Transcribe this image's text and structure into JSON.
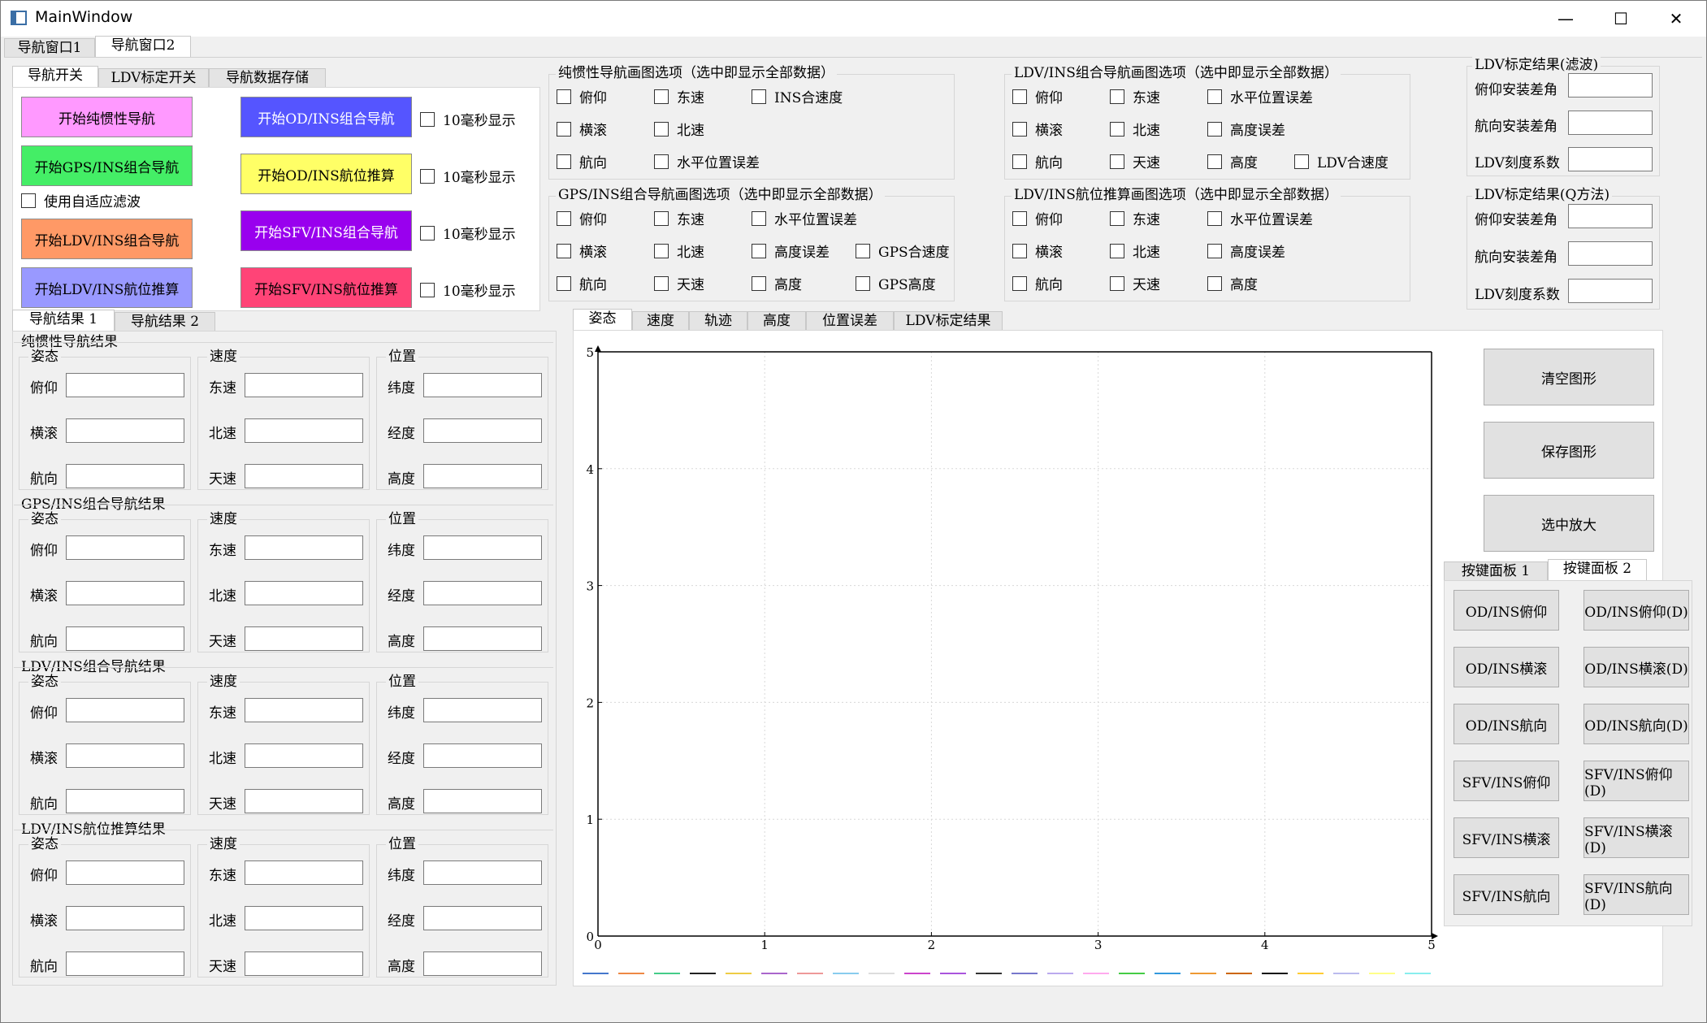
{
  "window": {
    "title": "MainWindow",
    "icons": {
      "minimize": "minimize-icon",
      "maximize": "maximize-icon",
      "close": "close-icon"
    }
  },
  "main_tabs": [
    {
      "label": "导航窗口1"
    },
    {
      "label": "导航窗口2"
    }
  ],
  "switch_tabs": [
    {
      "label": "导航开关"
    },
    {
      "label": "LDV标定开关"
    },
    {
      "label": "导航数据存储"
    }
  ],
  "nav_buttons": {
    "pure_ins": "开始纯惯性导航",
    "gps_ins": "开始GPS/INS组合导航",
    "ldv_ins": "开始LDV/INS组合导航",
    "ldv_dr": "开始LDV/INS航位推算",
    "od_ins": "开始OD/INS组合导航",
    "od_dr": "开始OD/INS航位推算",
    "sfv_ins": "开始SFV/INS组合导航",
    "sfv_dr": "开始SFV/INS航位推算"
  },
  "adaptive_filter": "使用自适应滤波",
  "ms10": "10毫秒显示",
  "plot_groups": [
    {
      "title": "纯惯性导航画图选项（选中即显示全部数据）",
      "items": [
        "俯仰",
        "东速",
        "INS合速度",
        "横滚",
        "北速",
        "航向",
        "水平位置误差"
      ]
    },
    {
      "title": "LDV/INS组合导航画图选项（选中即显示全部数据）",
      "items": [
        "俯仰",
        "东速",
        "水平位置误差",
        "横滚",
        "北速",
        "高度误差",
        "航向",
        "天速",
        "高度",
        "LDV合速度"
      ]
    },
    {
      "title": "GPS/INS组合导航画图选项（选中即显示全部数据）",
      "items": [
        "俯仰",
        "东速",
        "水平位置误差",
        "横滚",
        "北速",
        "高度误差",
        "GPS合速度",
        "航向",
        "天速",
        "高度",
        "GPS高度"
      ]
    },
    {
      "title": "LDV/INS航位推算画图选项（选中即显示全部数据）",
      "items": [
        "俯仰",
        "东速",
        "水平位置误差",
        "横滚",
        "北速",
        "高度误差",
        "航向",
        "天速",
        "高度"
      ]
    }
  ],
  "ldv_calib": [
    {
      "title": "LDV标定结果(滤波)",
      "rows": [
        "俯仰安装差角",
        "航向安装差角",
        "LDV刻度系数"
      ]
    },
    {
      "title": "LDV标定结果(Q方法)",
      "rows": [
        "俯仰安装差角",
        "航向安装差角",
        "LDV刻度系数"
      ]
    }
  ],
  "result_tabs": [
    {
      "label": "导航结果 1"
    },
    {
      "label": "导航结果 2"
    }
  ],
  "sub_labels": {
    "attitude": "姿态",
    "velocity": "速度",
    "position": "位置"
  },
  "att_rows": [
    "俯仰",
    "横滚",
    "航向"
  ],
  "vel_rows": [
    "东速",
    "北速",
    "天速"
  ],
  "pos_rows": [
    "纬度",
    "经度",
    "高度"
  ],
  "result_groups": [
    {
      "title": "纯惯性导航结果"
    },
    {
      "title": "GPS/INS组合导航结果"
    },
    {
      "title": "LDV/INS组合导航结果"
    },
    {
      "title": "LDV/INS航位推算结果"
    }
  ],
  "plot_tabs": [
    {
      "label": "姿态"
    },
    {
      "label": "速度"
    },
    {
      "label": "轨迹"
    },
    {
      "label": "高度"
    },
    {
      "label": "位置误差"
    },
    {
      "label": "LDV标定结果"
    }
  ],
  "plot_buttons": {
    "clear": "清空图形",
    "save": "保存图形",
    "zoom": "选中放大"
  },
  "key_tabs": [
    {
      "label": "按键面板 1"
    },
    {
      "label": "按键面板 2"
    }
  ],
  "key_buttons": [
    [
      "OD/INS俯仰",
      "OD/INS俯仰(D)"
    ],
    [
      "OD/INS横滚",
      "OD/INS横滚(D)"
    ],
    [
      "OD/INS航向",
      "OD/INS航向(D)"
    ],
    [
      "SFV/INS俯仰",
      "SFV/INS俯仰(D)"
    ],
    [
      "SFV/INS横滚",
      "SFV/INS横滚(D)"
    ],
    [
      "SFV/INS航向",
      "SFV/INS航向(D)"
    ]
  ],
  "colors": {
    "pure_ins": "#ff99ff",
    "gps_ins": "#44ee66",
    "ldv_ins": "#ff9966",
    "ldv_dr": "#9999ff",
    "od_ins": "#5555ff",
    "od_dr": "#ffff66",
    "sfv_ins": "#9900ee",
    "sfv_dr": "#ff4477"
  },
  "legend_colors": [
    "#4477cc",
    "#ee8844",
    "#44cc88",
    "#222222",
    "#eecc44",
    "#aa66cc",
    "#ee9999",
    "#88ccee",
    "#dddddd",
    "#cc44cc",
    "#aa55dd",
    "#333333",
    "#7777cc",
    "#bbaaee",
    "#ffaaee",
    "#44cc44",
    "#3399dd",
    "#ee9933",
    "#cc6600",
    "#111111",
    "#ffcc33",
    "#bbbbee",
    "#ffff88",
    "#88eeee"
  ],
  "chart_data": {
    "type": "line",
    "series": [],
    "xlim": [
      0,
      5
    ],
    "ylim": [
      0,
      5
    ],
    "x_ticks": [
      "0",
      "1",
      "2",
      "3",
      "4",
      "5"
    ],
    "y_ticks": [
      "0",
      "1",
      "2",
      "3",
      "4",
      "5"
    ],
    "grid": true
  }
}
